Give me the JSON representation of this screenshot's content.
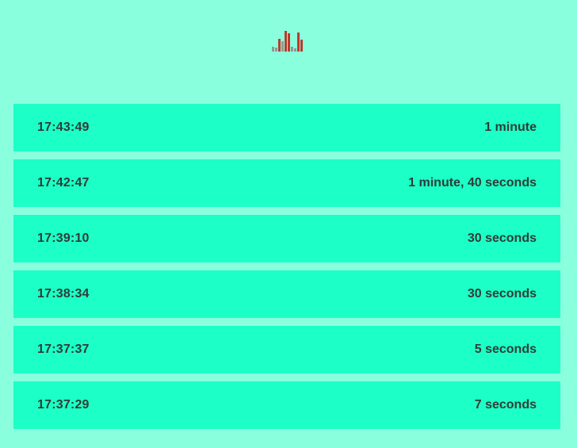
{
  "header": {
    "logo_icon": "equalizer-bars-icon",
    "colors": {
      "bar_light": "#8f9993",
      "bar_dark": "#c0392b"
    }
  },
  "entries": [
    {
      "time": "17:43:49",
      "duration": "1 minute"
    },
    {
      "time": "17:42:47",
      "duration": "1 minute, 40 seconds"
    },
    {
      "time": "17:39:10",
      "duration": "30 seconds"
    },
    {
      "time": "17:38:34",
      "duration": "30 seconds"
    },
    {
      "time": "17:37:37",
      "duration": "5 seconds"
    },
    {
      "time": "17:37:29",
      "duration": "7 seconds"
    }
  ],
  "colors": {
    "background": "#8affde",
    "row_background": "#1cffc6",
    "text": "#2f3b38"
  }
}
